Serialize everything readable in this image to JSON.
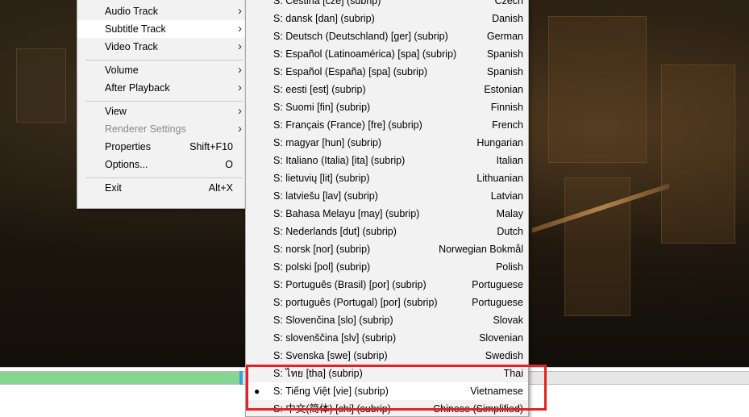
{
  "main_menu": {
    "items": [
      {
        "label": "Audio Track",
        "accel": "",
        "submenu": true,
        "disabled": false,
        "highlight": false
      },
      {
        "label": "Subtitle Track",
        "accel": "",
        "submenu": true,
        "disabled": false,
        "highlight": true
      },
      {
        "label": "Video Track",
        "accel": "",
        "submenu": true,
        "disabled": false,
        "highlight": false
      },
      {
        "label": "Volume",
        "accel": "",
        "submenu": true,
        "disabled": false,
        "highlight": false
      },
      {
        "label": "After Playback",
        "accel": "",
        "submenu": true,
        "disabled": false,
        "highlight": false
      },
      {
        "label": "View",
        "accel": "",
        "submenu": true,
        "disabled": false,
        "highlight": false
      },
      {
        "label": "Renderer Settings",
        "accel": "",
        "submenu": true,
        "disabled": true,
        "highlight": false
      },
      {
        "label": "Properties",
        "accel": "Shift+F10",
        "submenu": false,
        "disabled": false,
        "highlight": false
      },
      {
        "label": "Options...",
        "accel": "O",
        "submenu": false,
        "disabled": false,
        "highlight": false
      },
      {
        "label": "Exit",
        "accel": "Alt+X",
        "submenu": false,
        "disabled": false,
        "highlight": false
      }
    ],
    "arrow_icon": "chevron-right-icon"
  },
  "subtitle_menu": {
    "items": [
      {
        "label": "S: Čeština [cze] (subrip)",
        "lang": "Czech",
        "selected": false
      },
      {
        "label": "S: dansk [dan] (subrip)",
        "lang": "Danish",
        "selected": false
      },
      {
        "label": "S: Deutsch (Deutschland) [ger] (subrip)",
        "lang": "German",
        "selected": false
      },
      {
        "label": "S: Español (Latinoamérica) [spa] (subrip)",
        "lang": "Spanish",
        "selected": false
      },
      {
        "label": "S: Español (España) [spa] (subrip)",
        "lang": "Spanish",
        "selected": false
      },
      {
        "label": "S: eesti [est] (subrip)",
        "lang": "Estonian",
        "selected": false
      },
      {
        "label": "S: Suomi [fin] (subrip)",
        "lang": "Finnish",
        "selected": false
      },
      {
        "label": "S: Français (France) [fre] (subrip)",
        "lang": "French",
        "selected": false
      },
      {
        "label": "S: magyar [hun] (subrip)",
        "lang": "Hungarian",
        "selected": false
      },
      {
        "label": "S: Italiano (Italia) [ita] (subrip)",
        "lang": "Italian",
        "selected": false
      },
      {
        "label": "S: lietuvių [lit] (subrip)",
        "lang": "Lithuanian",
        "selected": false
      },
      {
        "label": "S: latviešu [lav] (subrip)",
        "lang": "Latvian",
        "selected": false
      },
      {
        "label": "S: Bahasa Melayu [may] (subrip)",
        "lang": "Malay",
        "selected": false
      },
      {
        "label": "S: Nederlands [dut] (subrip)",
        "lang": "Dutch",
        "selected": false
      },
      {
        "label": "S: norsk [nor] (subrip)",
        "lang": "Norwegian Bokmål",
        "selected": false
      },
      {
        "label": "S: polski [pol] (subrip)",
        "lang": "Polish",
        "selected": false
      },
      {
        "label": "S: Português (Brasil) [por] (subrip)",
        "lang": "Portuguese",
        "selected": false
      },
      {
        "label": "S: português (Portugal) [por] (subrip)",
        "lang": "Portuguese",
        "selected": false
      },
      {
        "label": "S: Slovenčina [slo] (subrip)",
        "lang": "Slovak",
        "selected": false
      },
      {
        "label": "S: slovenščina [slv] (subrip)",
        "lang": "Slovenian",
        "selected": false
      },
      {
        "label": "S: Svenska [swe] (subrip)",
        "lang": "Swedish",
        "selected": false
      },
      {
        "label": "S: ไทย [tha] (subrip)",
        "lang": "Thai",
        "selected": false
      },
      {
        "label": "S: Tiếng Việt [vie] (subrip)",
        "lang": "Vietnamese",
        "selected": true
      },
      {
        "label": "S: 中文(简体) [chi] (subrip)",
        "lang": "Chinese (Simplified)",
        "selected": false
      }
    ],
    "bullet_icon": "selected-bullet-icon"
  },
  "seekbar": {
    "progress": 0.32,
    "fill_color": "#86d692",
    "thumb_color": "#3ea0d8"
  },
  "annotation": {
    "highlight_color": "#e02424"
  }
}
